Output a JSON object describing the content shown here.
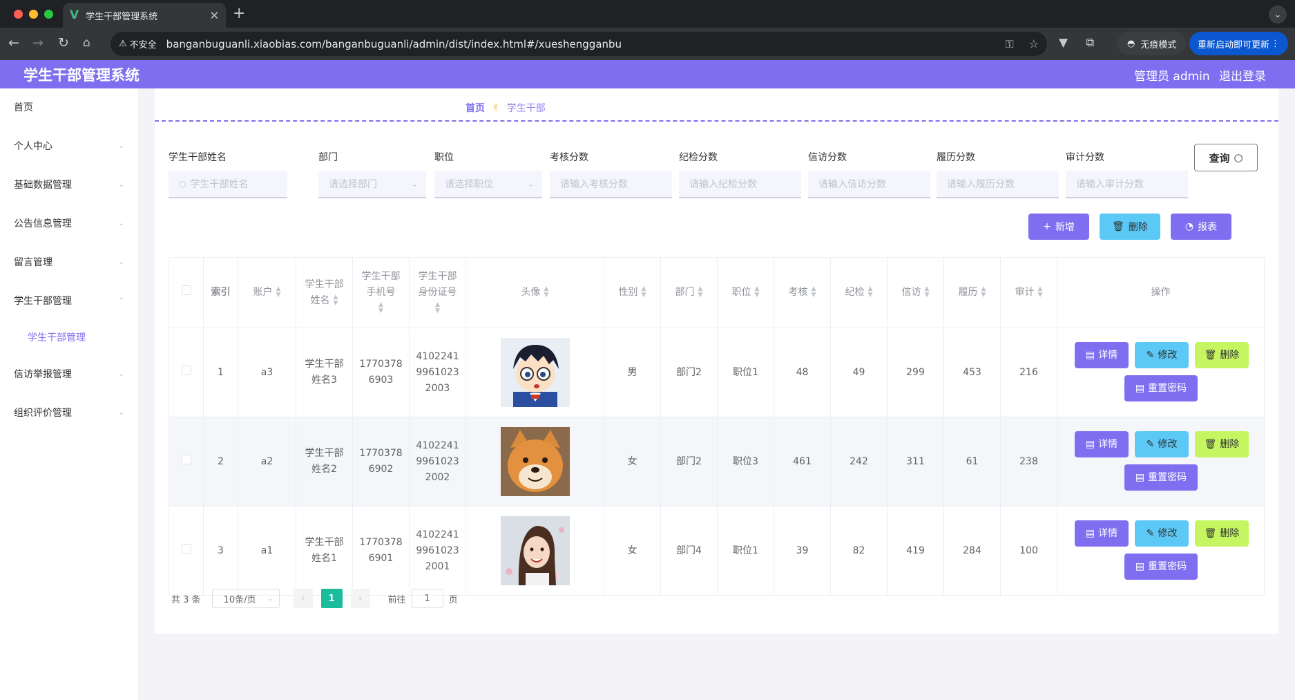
{
  "browser": {
    "tab_title": "学生干部管理系统",
    "security_label": "不安全",
    "url": "banganbuguanli.xiaobias.com/banganbuguanli/admin/dist/index.html#/xueshengganbu",
    "incognito_label": "无痕模式",
    "update_label": "重新启动即可更新"
  },
  "header": {
    "title": "学生干部管理系统",
    "user": "管理员 admin",
    "logout": "退出登录"
  },
  "sidebar": {
    "items": [
      {
        "label": "首页"
      },
      {
        "label": "个人中心"
      },
      {
        "label": "基础数据管理"
      },
      {
        "label": "公告信息管理"
      },
      {
        "label": "留言管理"
      },
      {
        "label": "学生干部管理"
      },
      {
        "label": "信访举报管理"
      },
      {
        "label": "组织评价管理"
      }
    ],
    "subitem": "学生干部管理"
  },
  "breadcrumb": {
    "home": "首页",
    "current": "学生干部"
  },
  "filters": [
    {
      "label": "学生干部姓名",
      "placeholder": "学生干部姓名"
    },
    {
      "label": "部门",
      "placeholder": "请选择部门"
    },
    {
      "label": "职位",
      "placeholder": "请选择职位"
    },
    {
      "label": "考核分数",
      "placeholder": "请输入考核分数"
    },
    {
      "label": "纪检分数",
      "placeholder": "请输入纪检分数"
    },
    {
      "label": "信访分数",
      "placeholder": "请输入信访分数"
    },
    {
      "label": "履历分数",
      "placeholder": "请输入履历分数"
    },
    {
      "label": "审计分数",
      "placeholder": "请输入审计分数"
    }
  ],
  "query_label": "查询",
  "actions": {
    "add": "新增",
    "delete": "删除",
    "report": "报表"
  },
  "colors": {
    "primary": "#7f6ff0",
    "info": "#5bc8f5",
    "warning": "#c5f560",
    "success": "#1abc9c"
  },
  "table": {
    "headers": {
      "index": "索引",
      "account": "账户",
      "name": [
        "学生干部",
        "姓名"
      ],
      "phone": [
        "学生干部",
        "手机号"
      ],
      "idcard": [
        "学生干部",
        "身份证号"
      ],
      "avatar": "头像",
      "gender": "性别",
      "dept": "部门",
      "position": "职位",
      "kaohe": "考核",
      "jijian": "纪检",
      "xinfang": "信访",
      "lvli": "履历",
      "shenji": "审计",
      "ops": "操作"
    },
    "rows": [
      {
        "index": "1",
        "account": "a3",
        "name": [
          "学生干部",
          "姓名3"
        ],
        "phone": [
          "1770378",
          "6903"
        ],
        "id": [
          "4102241",
          "9961023",
          "2003"
        ],
        "avatar": "cartoon-boy-glasses",
        "gender": "男",
        "dept": "部门2",
        "position": "职位1",
        "kaohe": "48",
        "jijian": "49",
        "xinfang": "299",
        "lvli": "453",
        "shenji": "216"
      },
      {
        "index": "2",
        "account": "a2",
        "name": [
          "学生干部",
          "姓名2"
        ],
        "phone": [
          "1770378",
          "6902"
        ],
        "id": [
          "4102241",
          "9961023",
          "2002"
        ],
        "avatar": "shiba-dog",
        "gender": "女",
        "dept": "部门2",
        "position": "职位3",
        "kaohe": "461",
        "jijian": "242",
        "xinfang": "311",
        "lvli": "61",
        "shenji": "238"
      },
      {
        "index": "3",
        "account": "a1",
        "name": [
          "学生干部",
          "姓名1"
        ],
        "phone": [
          "1770378",
          "6901"
        ],
        "id": [
          "4102241",
          "9961023",
          "2001"
        ],
        "avatar": "girl-portrait",
        "gender": "女",
        "dept": "部门4",
        "position": "职位1",
        "kaohe": "39",
        "jijian": "82",
        "xinfang": "419",
        "lvli": "284",
        "shenji": "100"
      }
    ],
    "op_labels": {
      "detail": "详情",
      "edit": "修改",
      "delete": "删除",
      "reset": "重置密码"
    }
  },
  "pagination": {
    "total": "共 3 条",
    "page_size": "10条/页",
    "current": "1",
    "goto_label": "前往",
    "goto_value": "1",
    "page_suffix": "页"
  }
}
